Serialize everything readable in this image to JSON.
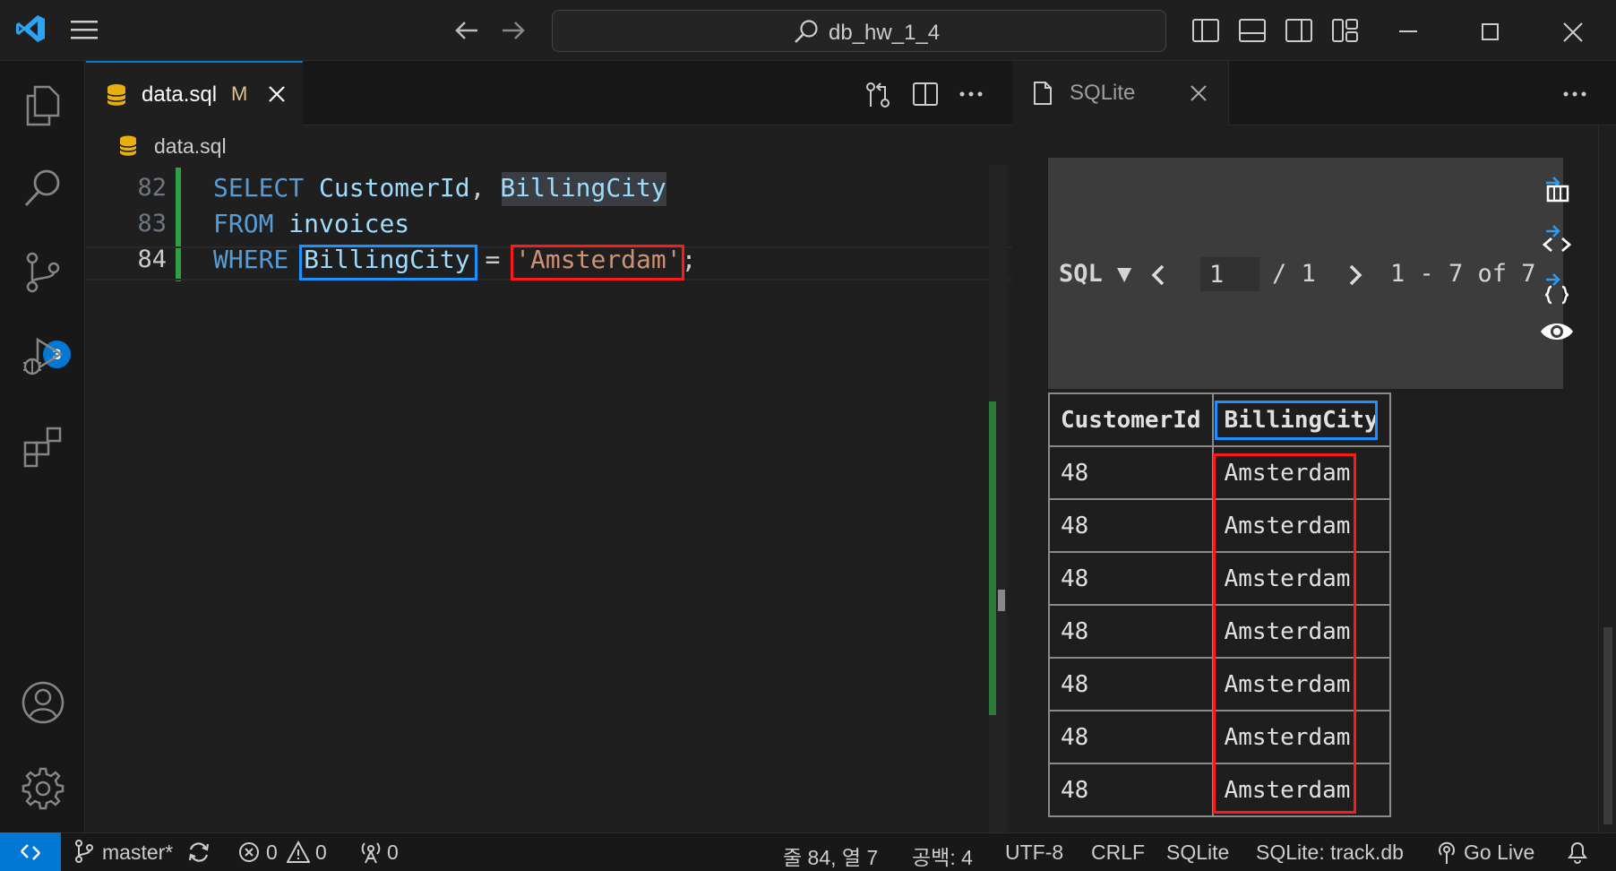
{
  "titlebar": {
    "search_text": "db_hw_1_4"
  },
  "activity": {
    "scm_badge": "3"
  },
  "editor": {
    "tab_label": "data.sql",
    "tab_modified": "M",
    "breadcrumb": "data.sql",
    "lines": [
      {
        "num": "82",
        "parts": [
          [
            "kw",
            "SELECT "
          ],
          [
            "id",
            "CustomerId"
          ],
          [
            "pl",
            ", "
          ],
          [
            "id",
            "BillingCity"
          ]
        ]
      },
      {
        "num": "83",
        "parts": [
          [
            "kw",
            "FROM "
          ],
          [
            "id",
            "invoices"
          ]
        ]
      },
      {
        "num": "84",
        "parts": [
          [
            "kw",
            "WHERE "
          ],
          [
            "id",
            "BillingCity"
          ],
          [
            "pl",
            " = "
          ],
          [
            "str",
            "'Amsterdam'"
          ],
          [
            "pl",
            ";"
          ]
        ]
      }
    ]
  },
  "results": {
    "tab_label": "SQLite",
    "sql_label": "SQL ▼",
    "page_input": "1",
    "page_total": "/ 1",
    "range": "1 - 7 of 7",
    "columns": [
      "CustomerId",
      "BillingCity"
    ],
    "rows": [
      [
        "48",
        "Amsterdam"
      ],
      [
        "48",
        "Amsterdam"
      ],
      [
        "48",
        "Amsterdam"
      ],
      [
        "48",
        "Amsterdam"
      ],
      [
        "48",
        "Amsterdam"
      ],
      [
        "48",
        "Amsterdam"
      ],
      [
        "48",
        "Amsterdam"
      ]
    ]
  },
  "status": {
    "branch": "master*",
    "errors": "0",
    "warnings": "0",
    "ports": "0",
    "position": "줄 84, 열 7",
    "spaces": "공백: 4",
    "encoding": "UTF-8",
    "eol": "CRLF",
    "language": "SQLite",
    "db": "SQLite: track.db",
    "golive": "Go Live"
  },
  "colors": {
    "accent": "#0078d4",
    "highlight_blue": "#1e90ff",
    "highlight_red": "#ff1a1a"
  }
}
